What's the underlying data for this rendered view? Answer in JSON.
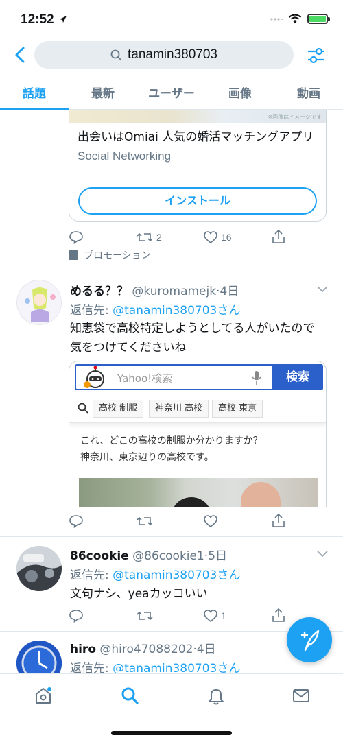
{
  "status_bar": {
    "time": "12:52"
  },
  "search": {
    "query": "tanamin380703"
  },
  "tabs": [
    {
      "label": "話題",
      "active": true
    },
    {
      "label": "最新",
      "active": false
    },
    {
      "label": "ユーザー",
      "active": false
    },
    {
      "label": "画像",
      "active": false
    },
    {
      "label": "動画",
      "active": false
    }
  ],
  "promo": {
    "image_caption": "※画像はイメージです",
    "title": "出会いはOmiai 人気の婚活マッチングアプリ",
    "category": "Social Networking",
    "install_label": "インストール",
    "retweets": "2",
    "likes": "16",
    "promoted_label": "プロモーション"
  },
  "tweets": [
    {
      "name": "めるる？？",
      "handle": "@kuromamejk",
      "time": "4日",
      "reply_prefix": "返信先: ",
      "reply_target": "@tanamin380703さん",
      "body": "知恵袋で高校特定しようとしてる人がいたので気をつけてくださいね",
      "likes": ""
    },
    {
      "name": "86cookie",
      "handle": "@86cookie1",
      "time": "5日",
      "reply_prefix": "返信先: ",
      "reply_target": "@tanamin380703さん",
      "body": "文句ナシ、yeaカッコいい",
      "likes": "1"
    },
    {
      "name": "hiro",
      "handle": "@hiro47088202",
      "time": "4日",
      "reply_prefix": "返信先: ",
      "reply_target": "@tanamin380703さん"
    }
  ],
  "yahoo_card": {
    "placeholder": "Yahoo!検索",
    "search_button": "検索",
    "chips": [
      "高校 制服",
      "神奈川 高校",
      "高校 東京"
    ],
    "question_line1": "これ、どこの高校の制服か分かりますか？",
    "question_line2": "神奈川、東京辺りの高校です。"
  },
  "colors": {
    "accent": "#1da1f2",
    "secondary_text": "#657786",
    "yahoo_blue": "#2b5fc9"
  }
}
